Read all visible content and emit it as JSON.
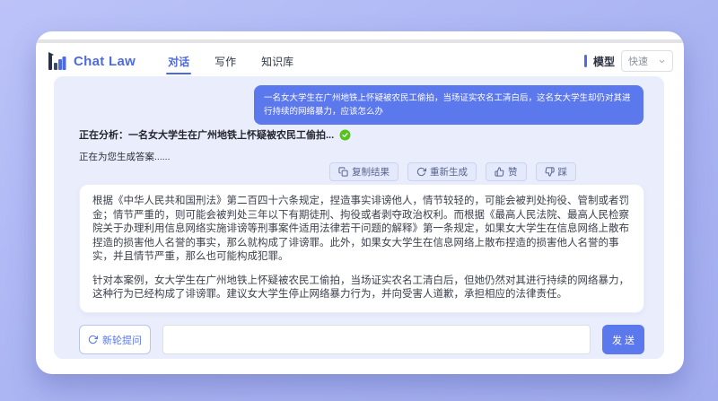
{
  "header": {
    "logo_text": "Chat Law",
    "tabs": [
      {
        "label": "对话",
        "active": true
      },
      {
        "label": "写作",
        "active": false
      },
      {
        "label": "知识库",
        "active": false
      }
    ],
    "model_label": "模型",
    "model_value": "快速"
  },
  "chat": {
    "user_message": "一名女大学生在广州地铁上怀疑被农民工偷拍，当场证实农名工清白后，这名女大学生却仍对其进行持续的网络暴力，应该怎么办",
    "status_analyzing": "正在分析：一名女大学生在广州地铁上怀疑被农民工偷拍...",
    "status_generating": "正在为您生成答案......",
    "actions": {
      "copy": "复制结果",
      "regenerate": "重新生成",
      "like": "赞",
      "dislike": "踩"
    },
    "answer_paragraphs": {
      "p1": "根据《中华人民共和国刑法》第二百四十六条规定，捏造事实诽谤他人，情节较轻的，可能会被判处拘役、管制或者罚金；情节严重的，则可能会被判处三年以下有期徒刑、拘役或者剥夺政治权利。而根据《最高人民法院、最高人民检察院关于办理利用信息网络实施诽谤等刑事案件适用法律若干问题的解释》第一条规定，如果女大学生在信息网络上散布捏造的损害他人名誉的事实，那么就构成了诽谤罪。此外，如果女大学生在信息网络上散布捏造的损害他人名誉的事实，并且情节严重，那么也可能构成犯罪。",
      "p2": "针对本案例，女大学生在广州地铁上怀疑被农民工偷拍，当场证实农名工清白后，但她仍然对其进行持续的网络暴力，这种行为已经构成了诽谤罪。建议女大学生停止网络暴力行为，并向受害人道歉，承担相应的法律责任。"
    }
  },
  "composer": {
    "new_round_label": "新轮提问",
    "input_value": "",
    "input_placeholder": "",
    "send_label": "发 送"
  },
  "colors": {
    "brand_blue": "#4d6bdf",
    "bubble_blue": "#5b78ec",
    "chat_background": "#eaedfb",
    "success_green": "#52c41a"
  }
}
